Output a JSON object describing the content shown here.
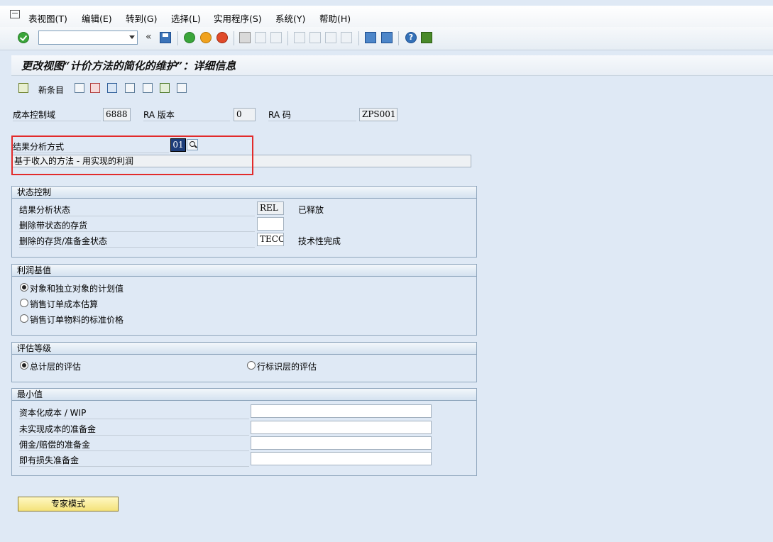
{
  "menubar": {
    "items": [
      "表视图(T)",
      "编辑(E)",
      "转到(G)",
      "选择(L)",
      "实用程序(S)",
      "系统(Y)",
      "帮助(H)"
    ]
  },
  "toolbar": {
    "command_field_value": "",
    "back_glyph": "«",
    "icons": [
      "check-icon",
      "save-icon",
      "back-icon",
      "exit-icon",
      "cancel-icon",
      "print-icon",
      "find-icon",
      "find-next-icon",
      "first-page-icon",
      "previous-page-icon",
      "next-page-icon",
      "last-page-icon",
      "new-session-icon",
      "shortcut-icon",
      "help-icon",
      "layout-icon"
    ]
  },
  "title": "更改视图“计价方法的简化的维护”：详细信息",
  "app_toolbar": {
    "new_entries_label": "新条目"
  },
  "header": {
    "controlling_area_label": "成本控制域",
    "controlling_area_value": "6888",
    "ra_version_label": "RA 版本",
    "ra_version_value": "0",
    "ra_key_label": "RA 码",
    "ra_key_value": "ZPS001"
  },
  "method": {
    "label": "结果分析方式",
    "value": "01",
    "description": "基于收入的方法 - 用实现的利润"
  },
  "status_control": {
    "title": "状态控制",
    "rows": [
      {
        "label": "结果分析状态",
        "value": "REL",
        "text": "已释放"
      },
      {
        "label": "删除带状态的存货",
        "value": "",
        "text": ""
      },
      {
        "label": "删除的存货/准备金状态",
        "value": "TECO",
        "text": "技术性完成"
      }
    ]
  },
  "profit_basis": {
    "title": "利润基值",
    "options": [
      {
        "label": "对象和独立对象的计划值",
        "selected": true
      },
      {
        "label": "销售订单成本估算",
        "selected": false
      },
      {
        "label": "销售订单物料的标准价格",
        "selected": false
      }
    ]
  },
  "valuation_level": {
    "title": "评估等级",
    "options": [
      {
        "label": "总计层的评估",
        "selected": true
      },
      {
        "label": "行标识层的评估",
        "selected": false
      }
    ]
  },
  "minimum_values": {
    "title": "最小值",
    "rows": [
      {
        "label": "资本化成本 / WIP",
        "value": ""
      },
      {
        "label": "未实现成本的准备金",
        "value": ""
      },
      {
        "label": "佣金/赔偿的准备金",
        "value": ""
      },
      {
        "label": "即有损失准备金",
        "value": ""
      }
    ]
  },
  "expert_mode_label": "专家模式"
}
